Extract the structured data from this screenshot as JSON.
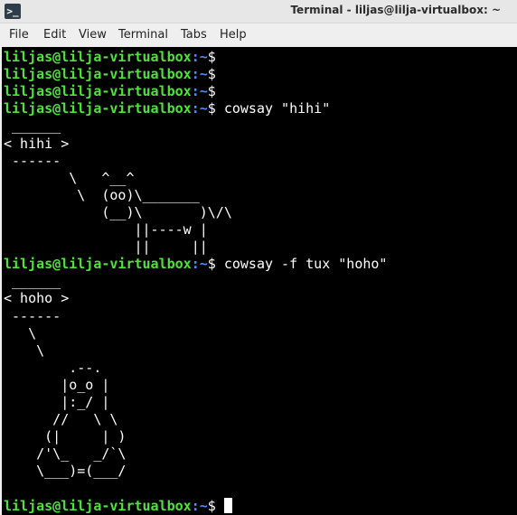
{
  "window": {
    "title": "Terminal - liljas@lilja-virtualbox: ~",
    "app_icon_glyph": ">_",
    "app_icon_name": "terminal-icon"
  },
  "menu": {
    "items": [
      "File",
      "Edit",
      "View",
      "Terminal",
      "Tabs",
      "Help"
    ]
  },
  "prompt": {
    "user_host": "liljas@lilja-virtualbox",
    "path": ":~",
    "symbol": "$"
  },
  "colors": {
    "prompt_user": "#4fe33b",
    "prompt_path": "#4d8cff",
    "terminal_bg": "#000000",
    "terminal_fg": "#ffffff"
  },
  "terminal": {
    "lines": [
      {
        "type": "prompt",
        "command": ""
      },
      {
        "type": "prompt",
        "command": ""
      },
      {
        "type": "prompt",
        "command": ""
      },
      {
        "type": "prompt",
        "command": " cowsay \"hihi\""
      },
      {
        "type": "output",
        "text": " ______"
      },
      {
        "type": "output",
        "text": "< hihi >"
      },
      {
        "type": "output",
        "text": " ------"
      },
      {
        "type": "output",
        "text": "        \\   ^__^"
      },
      {
        "type": "output",
        "text": "         \\  (oo)\\_______"
      },
      {
        "type": "output",
        "text": "            (__)\\       )\\/\\"
      },
      {
        "type": "output",
        "text": "                ||----w |"
      },
      {
        "type": "output",
        "text": "                ||     ||"
      },
      {
        "type": "prompt",
        "command": " cowsay -f tux \"hoho\""
      },
      {
        "type": "output",
        "text": " ______"
      },
      {
        "type": "output",
        "text": "< hoho >"
      },
      {
        "type": "output",
        "text": " ------"
      },
      {
        "type": "output",
        "text": "   \\"
      },
      {
        "type": "output",
        "text": "    \\"
      },
      {
        "type": "output",
        "text": "        .--."
      },
      {
        "type": "output",
        "text": "       |o_o |"
      },
      {
        "type": "output",
        "text": "       |:_/ |"
      },
      {
        "type": "output",
        "text": "      //   \\ \\"
      },
      {
        "type": "output",
        "text": "     (|     | )"
      },
      {
        "type": "output",
        "text": "    /'\\_   _/`\\"
      },
      {
        "type": "output",
        "text": "    \\___)=(___/"
      },
      {
        "type": "output",
        "text": ""
      },
      {
        "type": "prompt",
        "command": " ",
        "cursor": true
      }
    ]
  }
}
